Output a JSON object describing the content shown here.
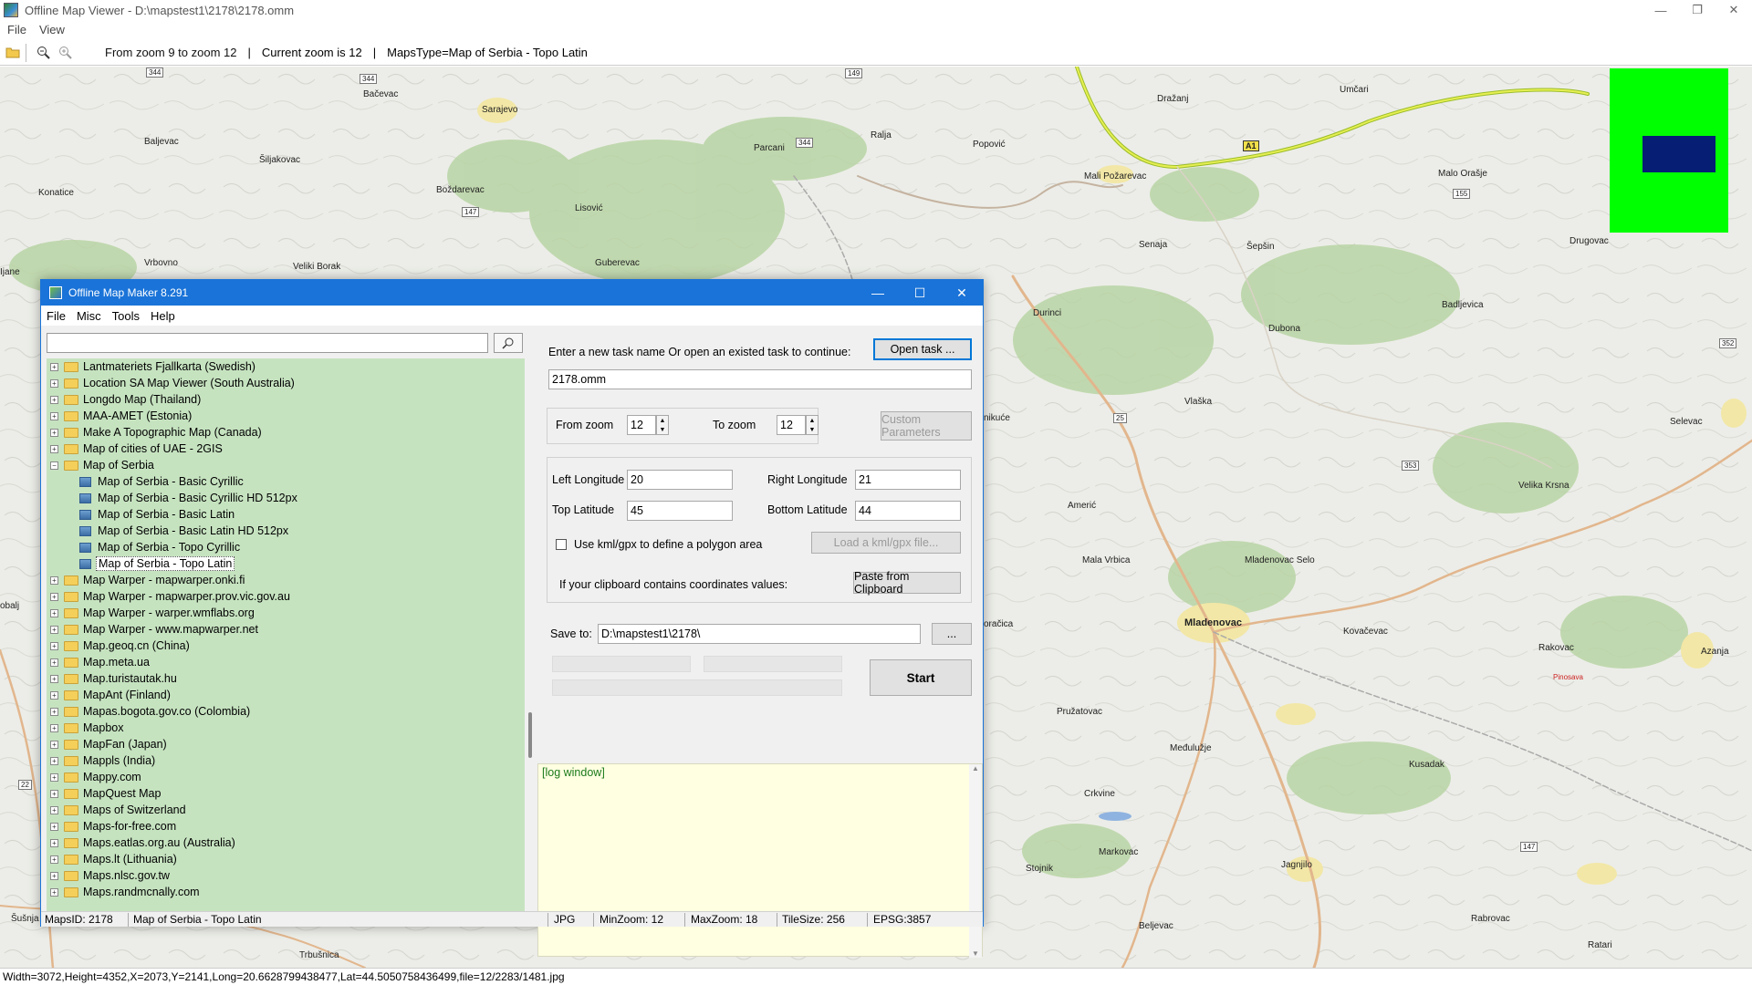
{
  "window": {
    "title": "Offline Map Viewer - D:\\mapstest1\\2178\\2178.omm",
    "menu": [
      "File",
      "View"
    ]
  },
  "toolbar": {
    "zoom_range": "From zoom 9 to zoom 12",
    "current_zoom": "Current zoom is 12",
    "maps_type": "MapsType=Map of Serbia - Topo Latin",
    "separator": "|"
  },
  "map": {
    "labels": [
      "Bačevac",
      "Baljevac",
      "Šiljakovac",
      "Konatice",
      "Vrbovno",
      "Veliki Borak",
      "Sarajevo",
      "Boždarevac",
      "Lisović",
      "Guberevac",
      "Parcani",
      "Ralja",
      "Popović",
      "Dražanj",
      "Umčari",
      "Mali Požarevac",
      "Malo Orašje",
      "Senaja",
      "Šepšin",
      "Drugovac",
      "Durinci",
      "Dubona",
      "Badljevica",
      "Vlaška",
      "Selevac",
      "Velika Krsna",
      "Amerić",
      "Mala Vrbica",
      "Mladenovac Selo",
      "Mladenovac",
      "Kovačevac",
      "Rakovac",
      "Azanja",
      "Pinosava",
      "Pružatovac",
      "Međulužje",
      "Kusadak",
      "Crkvine",
      "Markovac",
      "Stojnik",
      "Jagnjilo",
      "Beljevac",
      "Rabrovac",
      "Ratari",
      "Šušnja",
      "Trbušnica",
      "Ijane",
      "obalj",
      "nikuće",
      "oračica"
    ],
    "road_shields": [
      "344",
      "344",
      "149",
      "344",
      "147",
      "A1",
      "155",
      "352",
      "25",
      "353",
      "22",
      "147"
    ]
  },
  "main_status": "Width=3072,Height=4352,X=2073,Y=2141,Long=20.6628799438477,Lat=44.5050758436499,file=12/2283/1481.jpg",
  "dialog": {
    "title": "Offline Map Maker 8.291",
    "menu": [
      "File",
      "Misc",
      "Tools",
      "Help"
    ],
    "search": {
      "value": "",
      "button_icon": "search-icon"
    },
    "tree": [
      {
        "label": "Lantmateriets Fjallkarta (Swedish)",
        "type": "folder"
      },
      {
        "label": "Location SA Map Viewer (South Australia)",
        "type": "folder"
      },
      {
        "label": "Longdo Map (Thailand)",
        "type": "folder"
      },
      {
        "label": "MAA-AMET (Estonia)",
        "type": "folder"
      },
      {
        "label": "Make A Topographic Map (Canada)",
        "type": "folder"
      },
      {
        "label": "Map of cities of UAE - 2GIS",
        "type": "folder"
      },
      {
        "label": "Map of Serbia",
        "type": "folder-open"
      },
      {
        "label": "Map of Serbia - Basic Cyrillic",
        "type": "child"
      },
      {
        "label": "Map of Serbia - Basic Cyrillic HD 512px",
        "type": "child"
      },
      {
        "label": "Map of Serbia - Basic Latin",
        "type": "child"
      },
      {
        "label": "Map of Serbia - Basic Latin HD 512px",
        "type": "child"
      },
      {
        "label": "Map of Serbia - Topo Cyrillic",
        "type": "child"
      },
      {
        "label": "Map of Serbia - Topo Latin",
        "type": "child-selected"
      },
      {
        "label": "Map Warper - mapwarper.onki.fi",
        "type": "folder"
      },
      {
        "label": "Map Warper - mapwarper.prov.vic.gov.au",
        "type": "folder"
      },
      {
        "label": "Map Warper - warper.wmflabs.org",
        "type": "folder"
      },
      {
        "label": "Map Warper - www.mapwarper.net",
        "type": "folder"
      },
      {
        "label": "Map.geoq.cn (China)",
        "type": "folder"
      },
      {
        "label": "Map.meta.ua",
        "type": "folder"
      },
      {
        "label": "Map.turistautak.hu",
        "type": "folder"
      },
      {
        "label": "MapAnt (Finland)",
        "type": "folder"
      },
      {
        "label": "Mapas.bogota.gov.co (Colombia)",
        "type": "folder"
      },
      {
        "label": "Mapbox",
        "type": "folder"
      },
      {
        "label": "MapFan (Japan)",
        "type": "folder"
      },
      {
        "label": "Mappls (India)",
        "type": "folder"
      },
      {
        "label": "Mappy.com",
        "type": "folder"
      },
      {
        "label": "MapQuest Map",
        "type": "folder"
      },
      {
        "label": "Maps of Switzerland",
        "type": "folder"
      },
      {
        "label": "Maps-for-free.com",
        "type": "folder"
      },
      {
        "label": "Maps.eatlas.org.au (Australia)",
        "type": "folder"
      },
      {
        "label": "Maps.lt (Lithuania)",
        "type": "folder"
      },
      {
        "label": "Maps.nlsc.gov.tw",
        "type": "folder"
      },
      {
        "label": "Maps.randmcnally.com",
        "type": "folder"
      }
    ],
    "task_prompt": "Enter a new task name Or open an existed task to continue:",
    "open_task_label": "Open task ...",
    "task_name": "2178.omm",
    "from_zoom_label": "From zoom",
    "from_zoom": "12",
    "to_zoom_label": "To zoom",
    "to_zoom": "12",
    "custom_params_label": "Custom Parameters",
    "left_lon_label": "Left Longitude",
    "left_lon": "20",
    "right_lon_label": "Right Longitude",
    "right_lon": "21",
    "top_lat_label": "Top Latitude",
    "top_lat": "45",
    "bottom_lat_label": "Bottom Latitude",
    "bottom_lat": "44",
    "kml_label": "Use kml/gpx to define a polygon area",
    "load_kml_label": "Load a kml/gpx file...",
    "clipboard_prompt": "If your clipboard contains coordinates values:",
    "paste_label": "Paste from Clipboard",
    "save_to_label": "Save to:",
    "save_to": "D:\\mapstest1\\2178\\",
    "browse_label": "...",
    "start_label": "Start",
    "log_text": "[log window]",
    "status": {
      "maps_id": "MapsID: 2178",
      "map_name": "Map of Serbia - Topo Latin",
      "format": "JPG",
      "min_zoom": "MinZoom: 12",
      "max_zoom": "MaxZoom: 18",
      "tile_size": "TileSize: 256",
      "epsg": "EPSG:3857"
    }
  }
}
